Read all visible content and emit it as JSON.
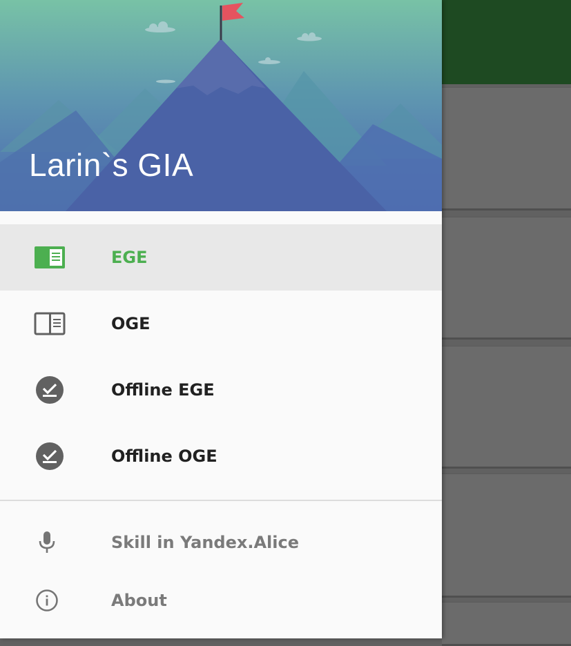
{
  "app": {
    "title": "Larin`s GIA"
  },
  "colors": {
    "accent": "#4caf50",
    "toolbar": "#1e4a22",
    "header_top": "#78c2a6",
    "header_bottom": "#4b67b0"
  },
  "menu": {
    "items": [
      {
        "label": "EGE",
        "icon": "book-open-icon",
        "active": true
      },
      {
        "label": "OGE",
        "icon": "book-open-outline-icon",
        "active": false
      },
      {
        "label": "Offline EGE",
        "icon": "download-done-icon",
        "active": false
      },
      {
        "label": "Offline OGE",
        "icon": "download-done-icon",
        "active": false
      }
    ]
  },
  "secondary_menu": {
    "items": [
      {
        "label": "Skill in Yandex.Alice",
        "icon": "microphone-icon"
      },
      {
        "label": "About",
        "icon": "info-icon"
      }
    ]
  }
}
